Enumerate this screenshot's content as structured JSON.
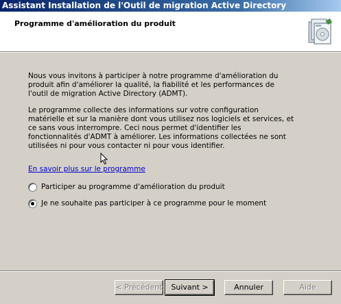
{
  "window": {
    "title": "Assistant Installation de l'Outil de migration Active Directory"
  },
  "header": {
    "title": "Programme d'amélioration du produit",
    "icon": "installer-box-icon"
  },
  "main": {
    "paragraph1": "Nous vous invitons à participer à notre programme d'amélioration du produit afin d'améliorer la qualité, la fiabilité et les performances de l'outil de migration Active Directory (ADMT).",
    "paragraph2": "Le programme collecte des informations sur votre configuration matérielle et sur la manière dont vous utilisez nos logiciels et services, et ce sans vous interrompre. Ceci nous permet d'identifier les fonctionnalités d'ADMT à améliorer. Les informations collectées ne sont utilisées ni pour vous contacter ni pour vous identifier.",
    "link": "En savoir plus sur le programme",
    "options": [
      {
        "label": "Participer au programme d'amélioration du produit",
        "checked": false
      },
      {
        "label": "Je ne souhaite pas participer à ce programme pour le moment",
        "checked": true
      }
    ]
  },
  "buttons": {
    "back": "< Précédent",
    "next": "Suivant >",
    "cancel": "Annuler",
    "help": "Aide"
  }
}
